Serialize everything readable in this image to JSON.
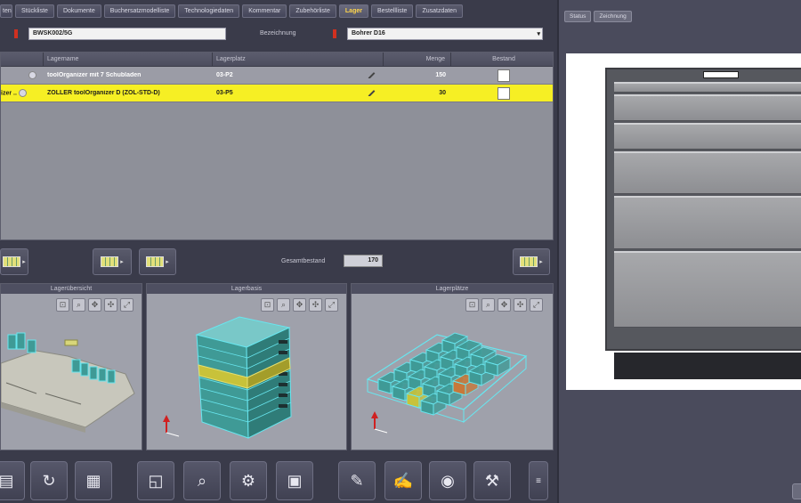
{
  "tabs": [
    {
      "label": "ten",
      "active": false
    },
    {
      "label": "Stückliste",
      "active": false
    },
    {
      "label": "Dokumente",
      "active": false
    },
    {
      "label": "Buchersatzmodelliste",
      "active": false
    },
    {
      "label": "Technologiedaten",
      "active": false
    },
    {
      "label": "Kommentar",
      "active": false
    },
    {
      "label": "Zubehörliste",
      "active": false
    },
    {
      "label": "Lager",
      "active": true
    },
    {
      "label": "Bestellliste",
      "active": false
    },
    {
      "label": "Zusatzdaten",
      "active": false
    }
  ],
  "header": {
    "id_value": "BWSK002/5G",
    "designation_label": "Bezeichnung",
    "designation_value": "Bohrer D16"
  },
  "table": {
    "columns": [
      "Lagername",
      "Lagerplatz",
      "Menge",
      "Bestand"
    ],
    "rows": [
      {
        "name": "toolOrganizer mit 7 Schubladen",
        "place": "03-P2",
        "qty": "150",
        "selected": false
      },
      {
        "name": "ZOLLER toolOrganizer D (ZOL-STD-D)",
        "prefix": "izer ..",
        "place": "03-P5",
        "qty": "30",
        "selected": true
      }
    ]
  },
  "midbar": {
    "total_label": "Gesamtbestand",
    "total_value": "170"
  },
  "panels": [
    {
      "title": "Lagerübersicht"
    },
    {
      "title": "Lagerbasis"
    },
    {
      "title": "Lagerplätze"
    }
  ],
  "right": {
    "tabs": [
      "Status",
      "Zeichnung"
    ]
  },
  "colors": {
    "selected_row": "#f6ef24",
    "active_tab_text": "#ffd54a",
    "cube_fill": "#3f9a96",
    "cube_edge": "#68e6ef",
    "highlight_layer": "#c8c23a",
    "highlight_cell_orange": "#c8783a"
  }
}
